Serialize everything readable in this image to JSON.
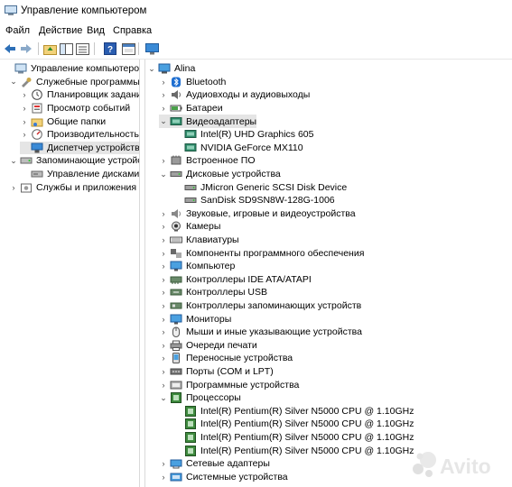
{
  "window": {
    "title": "Управление компьютером"
  },
  "menu": [
    "Файл",
    "Действие",
    "Вид",
    "Справка"
  ],
  "left_tree": [
    {
      "label": "Управление компьютером (лс",
      "icon": "computer-mgmt-icon",
      "exp": ""
    },
    {
      "label": "Служебные программы",
      "icon": "tools-icon",
      "exp": "v"
    },
    {
      "label": "Планировщик заданий",
      "icon": "clock-icon",
      "exp": ">"
    },
    {
      "label": "Просмотр событий",
      "icon": "event-viewer-icon",
      "exp": ">"
    },
    {
      "label": "Общие папки",
      "icon": "shared-folder-icon",
      "exp": ">"
    },
    {
      "label": "Производительность",
      "icon": "performance-icon",
      "exp": ">"
    },
    {
      "label": "Диспетчер устройств",
      "icon": "device-manager-icon",
      "exp": "",
      "selected": true
    },
    {
      "label": "Запоминающие устройств",
      "icon": "storage-icon",
      "exp": "v"
    },
    {
      "label": "Управление дисками",
      "icon": "disk-mgmt-icon",
      "exp": ""
    },
    {
      "label": "Службы и приложения",
      "icon": "services-icon",
      "exp": ">"
    }
  ],
  "device_tree": [
    {
      "label": "Alina",
      "icon": "computer-icon",
      "exp": "v",
      "level": 0
    },
    {
      "label": "Bluetooth",
      "icon": "bluetooth-icon",
      "exp": ">",
      "level": 1
    },
    {
      "label": "Аудиовходы и аудиовыходы",
      "icon": "speaker-icon",
      "exp": ">",
      "level": 1
    },
    {
      "label": "Батареи",
      "icon": "battery-icon",
      "exp": ">",
      "level": 1
    },
    {
      "label": "Видеоадаптеры",
      "icon": "display-adapter-icon",
      "exp": "v",
      "level": 1,
      "selected": true
    },
    {
      "label": "Intel(R) UHD Graphics 605",
      "icon": "display-adapter-icon",
      "exp": "",
      "level": 2
    },
    {
      "label": "NVIDIA GeForce MX110",
      "icon": "display-adapter-icon",
      "exp": "",
      "level": 2
    },
    {
      "label": "Встроенное ПО",
      "icon": "firmware-icon",
      "exp": ">",
      "level": 1
    },
    {
      "label": "Дисковые устройства",
      "icon": "disk-drive-icon",
      "exp": "v",
      "level": 1
    },
    {
      "label": "JMicron Generic SCSI Disk Device",
      "icon": "disk-drive-icon",
      "exp": "",
      "level": 2
    },
    {
      "label": "SanDisk SD9SN8W-128G-1006",
      "icon": "disk-drive-icon",
      "exp": "",
      "level": 2
    },
    {
      "label": "Звуковые, игровые и видеоустройства",
      "icon": "sound-icon",
      "exp": ">",
      "level": 1
    },
    {
      "label": "Камеры",
      "icon": "camera-icon",
      "exp": ">",
      "level": 1
    },
    {
      "label": "Клавиатуры",
      "icon": "keyboard-icon",
      "exp": ">",
      "level": 1
    },
    {
      "label": "Компоненты программного обеспечения",
      "icon": "software-component-icon",
      "exp": ">",
      "level": 1
    },
    {
      "label": "Компьютер",
      "icon": "monitor-icon",
      "exp": ">",
      "level": 1
    },
    {
      "label": "Контроллеры IDE ATA/ATAPI",
      "icon": "ide-controller-icon",
      "exp": ">",
      "level": 1
    },
    {
      "label": "Контроллеры USB",
      "icon": "usb-icon",
      "exp": ">",
      "level": 1
    },
    {
      "label": "Контроллеры запоминающих устройств",
      "icon": "storage-controller-icon",
      "exp": ">",
      "level": 1
    },
    {
      "label": "Мониторы",
      "icon": "monitor-icon",
      "exp": ">",
      "level": 1
    },
    {
      "label": "Мыши и иные указывающие устройства",
      "icon": "mouse-icon",
      "exp": ">",
      "level": 1
    },
    {
      "label": "Очереди печати",
      "icon": "printer-icon",
      "exp": ">",
      "level": 1
    },
    {
      "label": "Переносные устройства",
      "icon": "portable-device-icon",
      "exp": ">",
      "level": 1
    },
    {
      "label": "Порты (COM и LPT)",
      "icon": "port-icon",
      "exp": ">",
      "level": 1
    },
    {
      "label": "Программные устройства",
      "icon": "software-device-icon",
      "exp": ">",
      "level": 1
    },
    {
      "label": "Процессоры",
      "icon": "processor-icon",
      "exp": "v",
      "level": 1
    },
    {
      "label": "Intel(R) Pentium(R) Silver N5000 CPU @ 1.10GHz",
      "icon": "processor-icon",
      "exp": "",
      "level": 2
    },
    {
      "label": "Intel(R) Pentium(R) Silver N5000 CPU @ 1.10GHz",
      "icon": "processor-icon",
      "exp": "",
      "level": 2
    },
    {
      "label": "Intel(R) Pentium(R) Silver N5000 CPU @ 1.10GHz",
      "icon": "processor-icon",
      "exp": "",
      "level": 2
    },
    {
      "label": "Intel(R) Pentium(R) Silver N5000 CPU @ 1.10GHz",
      "icon": "processor-icon",
      "exp": "",
      "level": 2
    },
    {
      "label": "Сетевые адаптеры",
      "icon": "network-adapter-icon",
      "exp": ">",
      "level": 1
    },
    {
      "label": "Системные устройства",
      "icon": "system-device-icon",
      "exp": ">",
      "level": 1
    }
  ],
  "watermark": {
    "text": "Avito"
  }
}
